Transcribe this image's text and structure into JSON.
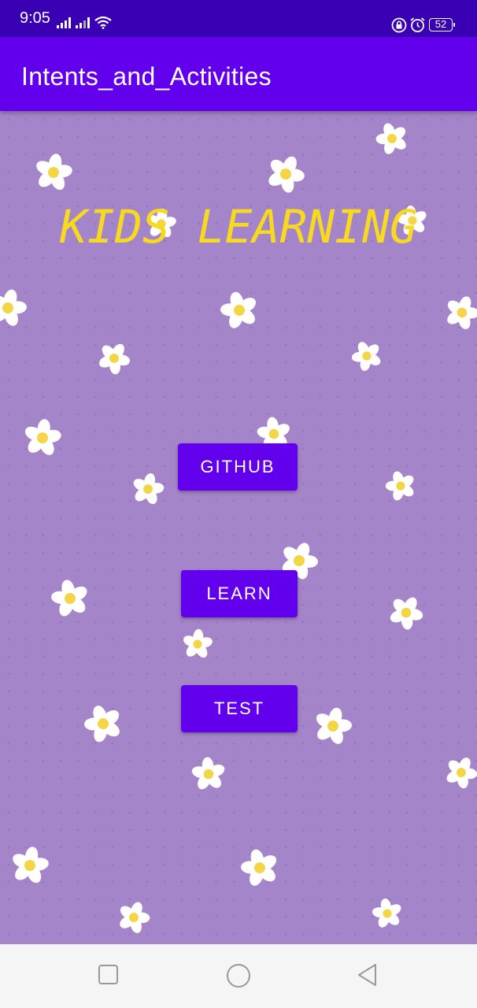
{
  "status_bar": {
    "time": "9:05",
    "battery": "52",
    "icons": [
      "signal-icon",
      "signal-icon",
      "wifi-icon",
      "lock-icon",
      "alarm-icon",
      "battery-icon"
    ]
  },
  "app_bar": {
    "title": "Intents_and_Activities"
  },
  "main": {
    "headline": "KIDS LEARNING",
    "buttons": {
      "github": "GITHUB",
      "learn": "LEARN",
      "test": "TEST"
    },
    "background": "flower-pattern"
  },
  "nav_bar": {
    "icons": [
      "recents-icon",
      "home-icon",
      "back-icon"
    ]
  },
  "colors": {
    "status_bar": "#3a00b3",
    "primary": "#6200ee",
    "background": "#a585c9",
    "headline": "#f7da1f"
  }
}
